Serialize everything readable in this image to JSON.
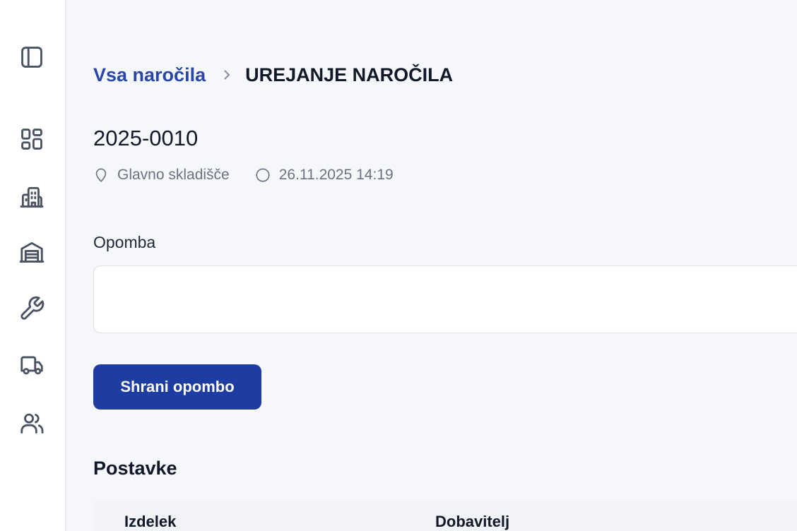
{
  "sidebar": {
    "items": [
      {
        "icon": "sidebar-toggle-icon"
      },
      {
        "icon": "dashboard-icon"
      },
      {
        "icon": "building-icon"
      },
      {
        "icon": "warehouse-icon"
      },
      {
        "icon": "wrench-icon"
      },
      {
        "icon": "truck-icon"
      },
      {
        "icon": "users-icon"
      }
    ]
  },
  "breadcrumb": {
    "link": "Vsa naročila",
    "current": "UREJANJE NAROČILA"
  },
  "order": {
    "number": "2025-0010",
    "location": "Glavno skladišče",
    "datetime": "26.11.2025 14:19"
  },
  "note": {
    "label": "Opomba",
    "value": "",
    "save_label": "Shrani opombo"
  },
  "items": {
    "title": "Postavke",
    "columns": [
      "Izdelek",
      "Dobavitelj"
    ]
  },
  "colors": {
    "accent": "#1e3da3",
    "link": "#2846a8",
    "background": "#f6f7fb"
  }
}
